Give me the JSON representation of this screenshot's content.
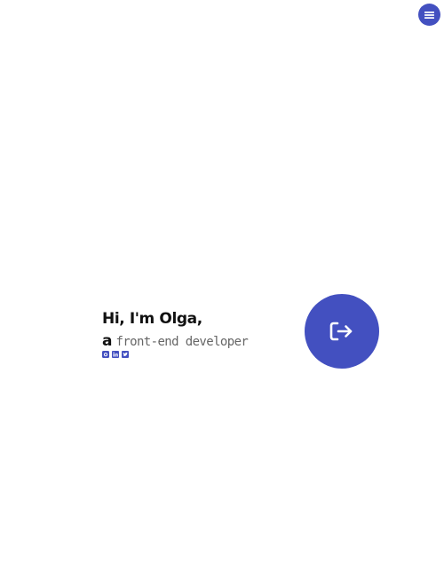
{
  "nav": {
    "menu_icon": "bars-icon",
    "accent": "#4350c0"
  },
  "intro": {
    "greeting": "Hi, I'm Olga,",
    "article": "a",
    "role": "front-end developer"
  },
  "social": [
    {
      "icon": "github-icon"
    },
    {
      "icon": "linkedin-icon"
    },
    {
      "icon": "twitter-icon"
    }
  ],
  "cta": {
    "icon": "sign-in-icon",
    "color": "#4350c0"
  }
}
